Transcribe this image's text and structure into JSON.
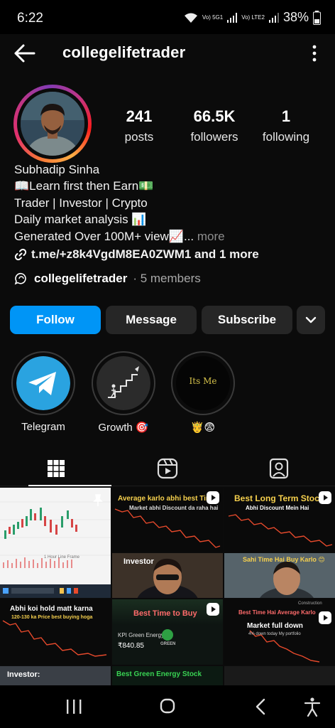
{
  "status": {
    "time": "6:22",
    "net1": "Vo) 5G1",
    "net2": "Vo) LTE2",
    "battery": "38%"
  },
  "header": {
    "username": "collegelifetrader"
  },
  "profile": {
    "stats": [
      {
        "value": "241",
        "label": "posts"
      },
      {
        "value": "66.5K",
        "label": "followers"
      },
      {
        "value": "1",
        "label": "following"
      }
    ],
    "name": "Subhadip Sinha",
    "bio_lines": [
      "📖Learn first then Earn💵",
      "Trader | Investor | Crypto",
      "Daily market analysis  📊",
      "Generated Over 100M+ view📈..."
    ],
    "more_label": " more",
    "link_text": "t.me/+z8k4VgdM8EA0ZWM1 and 1 more",
    "channel_name": "collegelifetrader",
    "channel_members": "· 5 members"
  },
  "actions": {
    "follow": "Follow",
    "message": "Message",
    "subscribe": "Subscribe"
  },
  "highlights": [
    {
      "label": "Telegram"
    },
    {
      "label": "Growth 🎯"
    },
    {
      "label": "🤴😨",
      "inner_text": "Its Me"
    }
  ],
  "grid": {
    "captions": {
      "c2": "Average karlo abhi best Time",
      "c2b": "Market abhi Discount da raha hai",
      "c3": "Best Long Term Stock",
      "c3b": "Abhi Discount Mein Hai",
      "c4": "Investor",
      "c5": "Sahi Time Hai Buy Karlo 😊",
      "c6": "Abhi koi hold matt karna",
      "c6b": "120-130 ka Price best buying hoga",
      "c7": "Best Time to Buy",
      "c7b": "KPI Green Energy",
      "c7c": "₹840.85",
      "c7d": "GREEN",
      "c8": "Best Time Hai Average Karlo",
      "c8b": "Market full down",
      "c8c": "4% down today My portfolio",
      "c8d": "Construction",
      "c9": "Investor:",
      "c10": "Best Green Energy Stock",
      "c1": "1 Hour Line Frame"
    }
  },
  "colors": {
    "follow": "#0095f6",
    "button": "#262626",
    "bg": "#0b0b0b",
    "chart_red": "#e84a2c",
    "caption_yellow": "#f6d04d",
    "caption_green": "#39d353"
  }
}
